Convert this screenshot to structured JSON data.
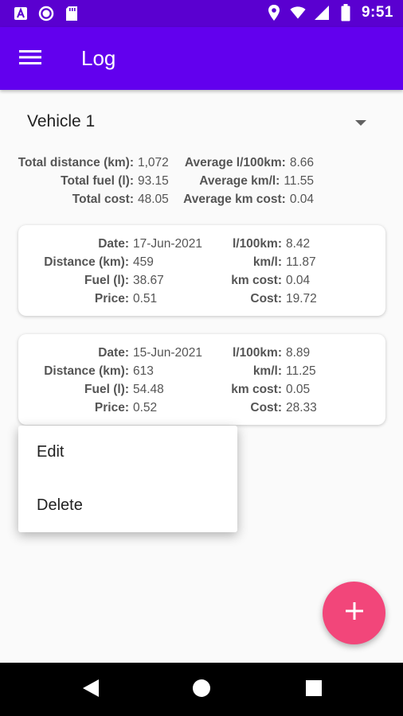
{
  "status_bar": {
    "time": "9:51",
    "icons": [
      "a-badge-icon",
      "circle-icon",
      "sd-card-icon",
      "location-icon",
      "wifi-icon",
      "signal-icon",
      "battery-icon"
    ]
  },
  "app_bar": {
    "title": "Log",
    "menu_icon": "hamburger-icon"
  },
  "vehicle": {
    "selected": "Vehicle 1"
  },
  "summary": {
    "total_distance_label": "Total distance (km):",
    "total_distance": "1,072",
    "total_fuel_label": "Total fuel (l):",
    "total_fuel": "93.15",
    "total_cost_label": "Total cost:",
    "total_cost": "48.05",
    "avg_l100_label": "Average l/100km:",
    "avg_l100": "8.66",
    "avg_kml_label": "Average km/l:",
    "avg_kml": "11.55",
    "avg_cost_label": "Average km cost:",
    "avg_cost": "0.04"
  },
  "entries": [
    {
      "date_label": "Date:",
      "date": "17-Jun-2021",
      "distance_label": "Distance (km):",
      "distance": "459",
      "fuel_label": "Fuel (l):",
      "fuel": "38.67",
      "price_label": "Price:",
      "price": "0.51",
      "l100_label": "l/100km:",
      "l100": "8.42",
      "kml_label": "km/l:",
      "kml": "11.87",
      "kmcost_label": "km cost:",
      "kmcost": "0.04",
      "cost_label": "Cost:",
      "cost": "19.72"
    },
    {
      "date_label": "Date:",
      "date": "15-Jun-2021",
      "distance_label": "Distance (km):",
      "distance": "613",
      "fuel_label": "Fuel (l):",
      "fuel": "54.48",
      "price_label": "Price:",
      "price": "0.52",
      "l100_label": "l/100km:",
      "l100": "8.89",
      "kml_label": "km/l:",
      "kml": "11.25",
      "kmcost_label": "km cost:",
      "kmcost": "0.05",
      "cost_label": "Cost:",
      "cost": "28.33"
    }
  ],
  "context_menu": {
    "items": [
      {
        "label": "Edit"
      },
      {
        "label": "Delete"
      }
    ]
  },
  "fab": {
    "icon": "plus-icon"
  },
  "nav_bar": {
    "icons": [
      "back-icon",
      "home-icon",
      "recents-icon"
    ]
  },
  "colors": {
    "status_bar": "#5a00d0",
    "app_bar": "#6200ee",
    "fab": "#f2467a",
    "background": "#fafafa"
  }
}
